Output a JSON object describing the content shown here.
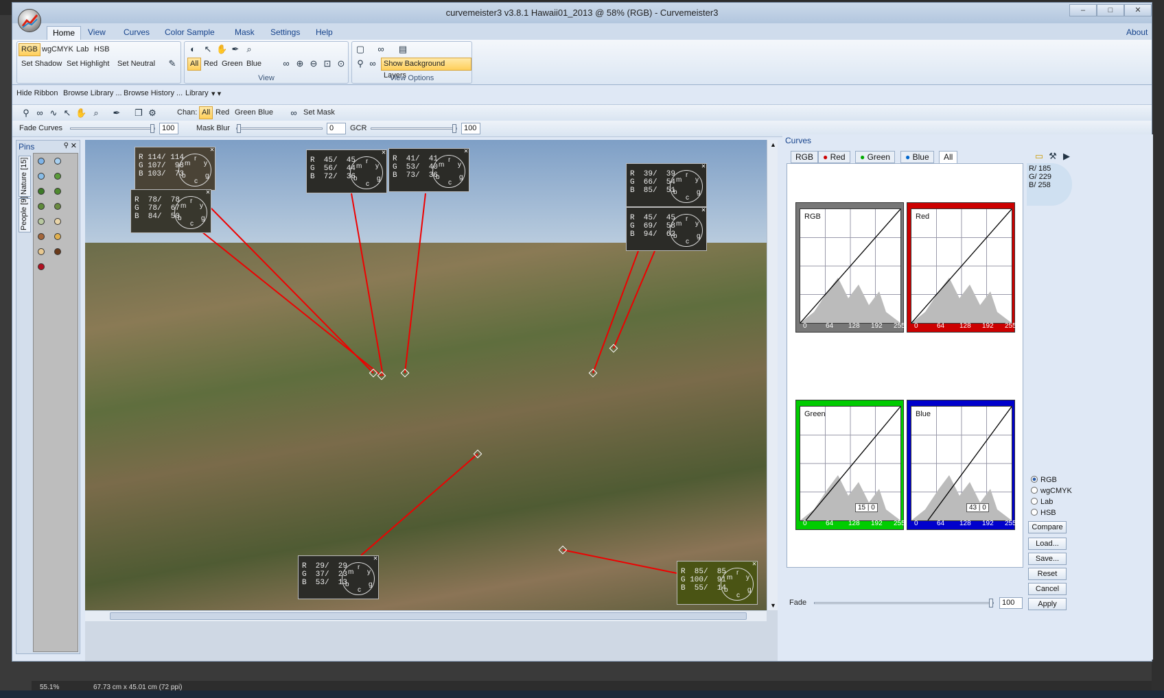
{
  "window": {
    "title": "curvemeister3 v3.8.1        Hawaii01_2013 @ 58% (RGB) - Curvemeister3",
    "about": "About"
  },
  "ribbon_tabs": [
    "Home",
    "View",
    "Curves",
    "Color Sample",
    "Mask",
    "Settings",
    "Help"
  ],
  "ribbon": {
    "modes": [
      "RGB",
      "wgCMYK",
      "Lab",
      "HSB"
    ],
    "set_buttons": [
      "Set Shadow",
      "Set Highlight",
      "Set Neutral"
    ],
    "channels": [
      "All",
      "Red",
      "Green",
      "Blue"
    ],
    "group_view": "View",
    "show_bg": "Show Background Layers",
    "group_view_options": "View Options"
  },
  "quickbar": [
    "Hide Ribbon",
    "Browse Library ...",
    "Browse History ...",
    "Library"
  ],
  "toolbar1": {
    "chan_label": "Chan:",
    "channels": [
      "All",
      "Red",
      "Green",
      "Blue"
    ],
    "set_mask": "Set Mask"
  },
  "toolbar2": {
    "fade_curves": "Fade Curves",
    "fade_value": "100",
    "mask_blur": "Mask Blur",
    "mask_value": "0",
    "gcr": "GCR",
    "gcr_value": "100"
  },
  "pins": {
    "title": "Pins",
    "tabs": [
      "Nature [15]",
      "People [9]"
    ]
  },
  "samples": [
    {
      "r": "R 114/ 114",
      "g": "G 107/  98",
      "b": "B 103/  73"
    },
    {
      "r": "R  78/  78",
      "g": "G  78/  67",
      "b": "B  84/  50"
    },
    {
      "r": "R  45/  45",
      "g": "G  56/  44",
      "b": "B  72/  36"
    },
    {
      "r": "R  41/  41",
      "g": "G  53/  40",
      "b": "B  73/  36"
    },
    {
      "r": "R  39/  39",
      "g": "G  66/  54",
      "b": "B  85/  51"
    },
    {
      "r": "R  45/  45",
      "g": "G  69/  58",
      "b": "B  94/  62"
    },
    {
      "r": "R  29/  29",
      "g": "G  37/  23",
      "b": "B  53/  13"
    },
    {
      "r": "R  85/  85",
      "g": "G 100/  91",
      "b": "B  55/  14"
    }
  ],
  "dial_letters": [
    "m",
    "r",
    "y",
    "b",
    "c",
    "g"
  ],
  "curves": {
    "title": "Curves",
    "tabs": [
      "RGB",
      "Red",
      "Green",
      "Blue",
      "All"
    ],
    "graphs": [
      {
        "title": "RGB",
        "color": "#777777"
      },
      {
        "title": "Red",
        "color": "#cc0000"
      },
      {
        "title": "Green",
        "color": "#00cc00"
      },
      {
        "title": "Blue",
        "color": "#0000cc"
      }
    ],
    "axis_ticks": [
      "0",
      "64",
      "128",
      "192",
      "255"
    ],
    "green_point": {
      "x": "15",
      "y": "0"
    },
    "blue_point": {
      "x": "43",
      "y": "0"
    },
    "readout": {
      "r": "R/ 185",
      "g": "G/ 229",
      "b": "B/ 258"
    },
    "modes": [
      "RGB",
      "wgCMYK",
      "Lab",
      "HSB"
    ],
    "buttons": [
      "Compare",
      "Load...",
      "Save...",
      "Reset",
      "Cancel",
      "Apply"
    ],
    "fade_label": "Fade",
    "fade_value": "100"
  },
  "status": {
    "zoom": "55.1%",
    "size": "67.73 cm x 45.01 cm (72 ppi)"
  }
}
